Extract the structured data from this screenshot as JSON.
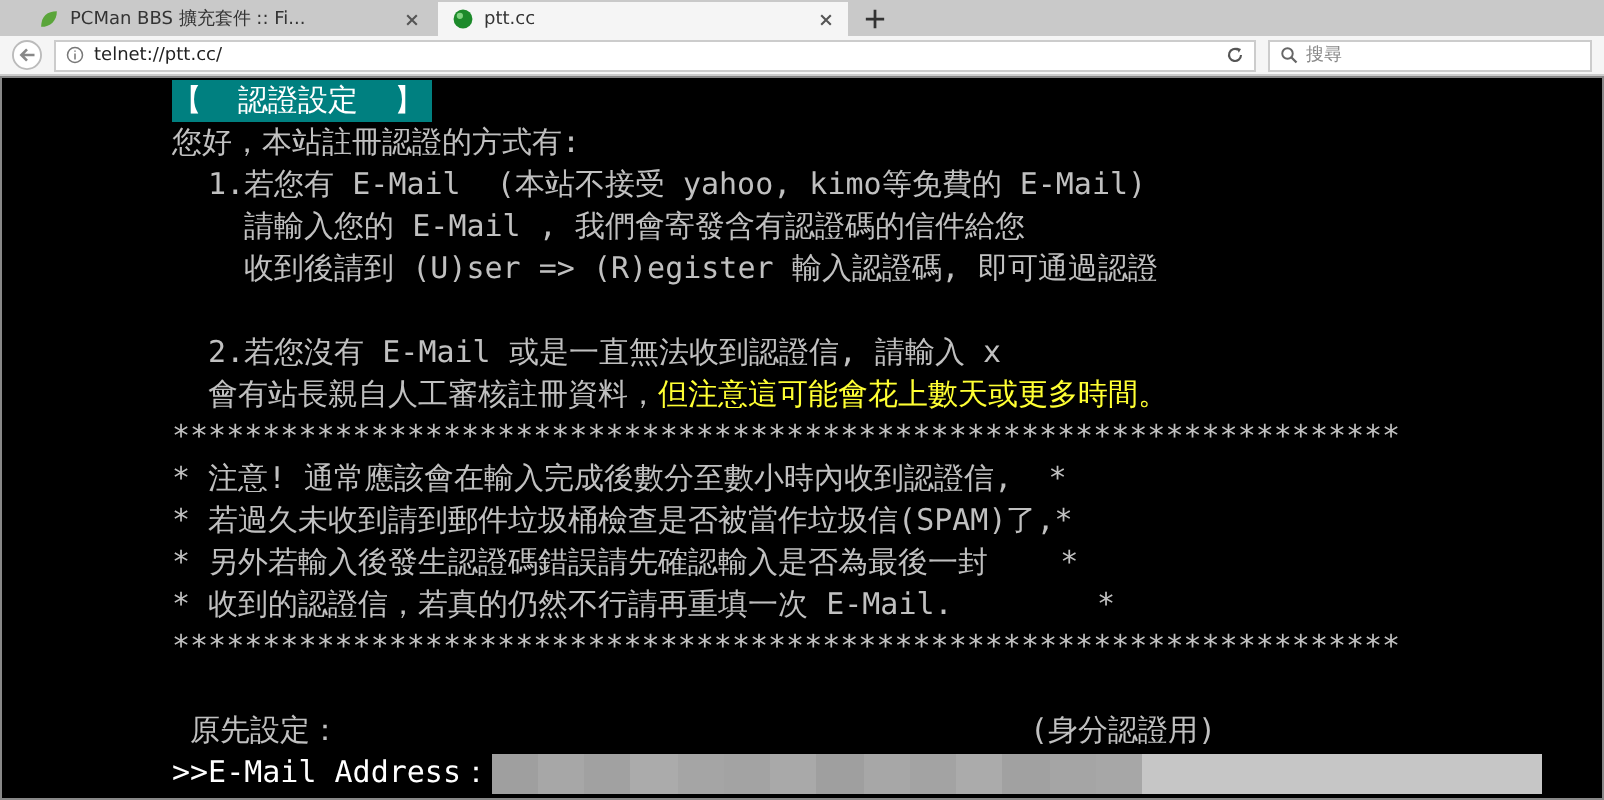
{
  "browser": {
    "tabs": [
      {
        "title": "PCMan BBS 擴充套件 :: Fi...",
        "selected": false
      },
      {
        "title": "ptt.cc",
        "selected": true
      }
    ],
    "address": "telnet://ptt.cc/",
    "search": {
      "placeholder": "搜尋"
    }
  },
  "terminal": {
    "lines": [
      {
        "segments": [
          {
            "kind": "header",
            "text": "【  認證設定  】"
          }
        ]
      },
      {
        "segments": [
          {
            "kind": "normal",
            "text": "您好，本站註冊認證的方式有:"
          }
        ]
      },
      {
        "segments": [
          {
            "kind": "normal",
            "text": "  1.若您有 E-Mail  (本站不接受 yahoo, kimo等免費的 E-Mail)"
          }
        ]
      },
      {
        "segments": [
          {
            "kind": "normal",
            "text": "    請輸入您的 E-Mail , 我們會寄發含有認證碼的信件給您"
          }
        ]
      },
      {
        "segments": [
          {
            "kind": "normal",
            "text": "    收到後請到 (U)ser => (R)egister 輸入認證碼, 即可通過認證"
          }
        ]
      },
      {
        "blank": true
      },
      {
        "segments": [
          {
            "kind": "normal",
            "text": "  2.若您沒有 E-Mail 或是一直無法收到認證信, 請輸入 x"
          }
        ]
      },
      {
        "segments": [
          {
            "kind": "normal",
            "text": "  會有站長親自人工審核註冊資料，"
          },
          {
            "kind": "warning",
            "text": "但注意這可能會花上數天或更多時間。"
          }
        ]
      },
      {
        "segments": [
          {
            "kind": "normal",
            "text": "********************************************************************"
          }
        ]
      },
      {
        "segments": [
          {
            "kind": "normal",
            "text": "* 注意! 通常應該會在輸入完成後數分至數小時內收到認證信,  *"
          }
        ]
      },
      {
        "segments": [
          {
            "kind": "normal",
            "text": "* 若過久未收到請到郵件垃圾桶檢查是否被當作垃圾信(SPAM)了,*"
          }
        ]
      },
      {
        "segments": [
          {
            "kind": "normal",
            "text": "* 另外若輸入後發生認證碼錯誤請先確認輸入是否為最後一封    *"
          }
        ]
      },
      {
        "segments": [
          {
            "kind": "normal",
            "text": "* 收到的認證信，若真的仍然不行請再重填一次 E-Mail.        *"
          }
        ]
      },
      {
        "segments": [
          {
            "kind": "normal",
            "text": "********************************************************************"
          }
        ]
      },
      {
        "blank": true
      },
      {
        "segments": [
          {
            "kind": "normal",
            "text": " 原先設定："
          },
          {
            "kind": "right",
            "text": "(身分認證用)"
          }
        ]
      }
    ],
    "prompt": {
      "label": ">>E-Mail Address：",
      "value_masked": true
    }
  }
}
